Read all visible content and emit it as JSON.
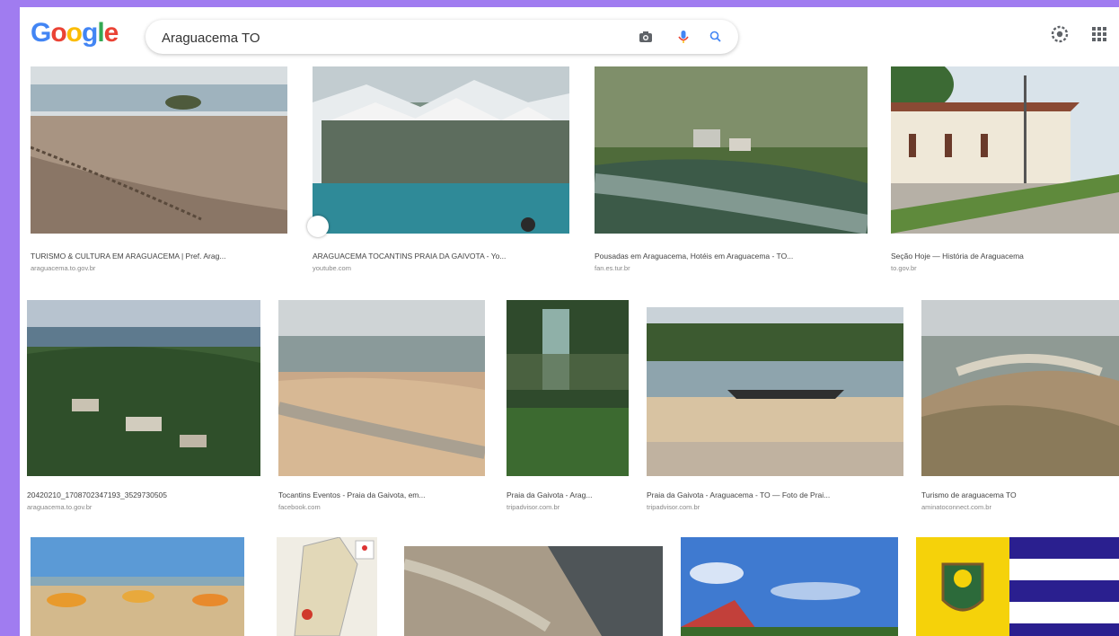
{
  "header": {
    "logo_letters": [
      {
        "ch": "G",
        "color": "#4285F4"
      },
      {
        "ch": "o",
        "color": "#EA4335"
      },
      {
        "ch": "o",
        "color": "#FBBC05"
      },
      {
        "ch": "g",
        "color": "#4285F4"
      },
      {
        "ch": "l",
        "color": "#34A853"
      },
      {
        "ch": "e",
        "color": "#EA4335"
      }
    ],
    "search_value": "Araguacema TO",
    "icons": [
      "camera-icon",
      "microphone-icon",
      "search-icon",
      "settings-icon",
      "apps-grid-icon"
    ]
  },
  "results": [
    {
      "caption": "TURISMO & CULTURA EM ARAGUACEMA | Pref. Arag...",
      "source": "araguacema.to.gov.br"
    },
    {
      "caption": "ARAGUACEMA TOCANTINS PRAIA DA GAIVOTA - Yo...",
      "source": "youtube.com"
    },
    {
      "caption": "Pousadas em Araguacema, Hotéis em Araguacema - TO...",
      "source": "fan.es.tur.br"
    },
    {
      "caption": "Seção Hoje — História de Araguacema",
      "source": "to.gov.br"
    },
    {
      "caption": "20420210_1708702347193_3529730505",
      "source": "araguacema.to.gov.br"
    },
    {
      "caption": "Tocantins Eventos - Praia da Gaivota, em...",
      "source": "facebook.com"
    },
    {
      "caption": "Praia da Gaivota - Arag...",
      "source": "tripadvisor.com.br"
    },
    {
      "caption": "Praia da Gaivota - Araguacema - TO — Foto de Prai...",
      "source": "tripadvisor.com.br"
    },
    {
      "caption": "Turismo de araguacema TO",
      "source": "aminatoconnect.com.br"
    },
    {
      "caption": "",
      "source": ""
    },
    {
      "caption": "",
      "source": ""
    },
    {
      "caption": "",
      "source": ""
    },
    {
      "caption": "",
      "source": ""
    },
    {
      "caption": "",
      "source": ""
    }
  ]
}
